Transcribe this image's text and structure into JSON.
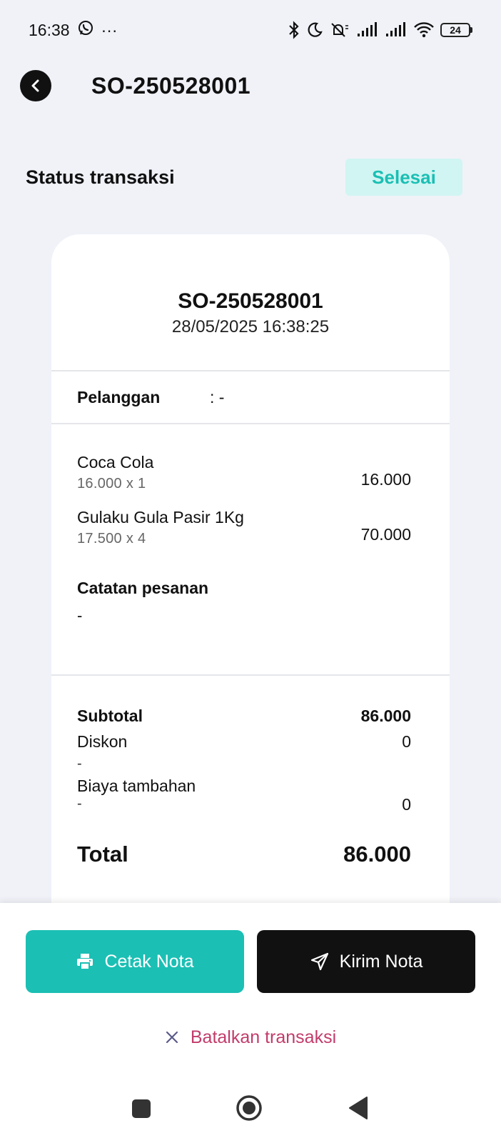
{
  "status_bar": {
    "time": "16:38",
    "more": "···",
    "battery": "24",
    "icons": [
      "whatsapp-icon",
      "bluetooth-icon",
      "moon-icon",
      "bell-off-icon",
      "signal-icon",
      "signal-icon",
      "wifi-icon",
      "battery-icon"
    ]
  },
  "header": {
    "title": "SO-250528001"
  },
  "status": {
    "label": "Status transaksi",
    "badge": "Selesai",
    "badge_color": "#1bbfb4",
    "badge_bg": "#d1f5f2"
  },
  "receipt": {
    "number": "SO-250528001",
    "date": "28/05/2025 16:38:25",
    "customer_label": "Pelanggan",
    "customer_value": ": -",
    "items": [
      {
        "name": "Coca Cola",
        "price": "16.000",
        "x": "x",
        "qty": "1",
        "total": "16.000"
      },
      {
        "name": "Gulaku Gula Pasir 1Kg",
        "price": "17.500",
        "x": "x",
        "qty": "4",
        "total": "70.000"
      }
    ],
    "notes_label": "Catatan pesanan",
    "notes_value": "-",
    "subtotal_label": "Subtotal",
    "subtotal_value": "86.000",
    "discount_label": "Diskon",
    "discount_value": "0",
    "discount_note": "-",
    "extra_label": "Biaya tambahan",
    "extra_value": "0",
    "extra_note": "-",
    "total_label": "Total",
    "total_value": "86.000"
  },
  "actions": {
    "print_label": "Cetak Nota",
    "send_label": "Kirim Nota",
    "cancel_label": "Batalkan transaksi",
    "print_color": "#1bbfb4",
    "send_color": "#111111",
    "cancel_color": "#c23b6b"
  }
}
